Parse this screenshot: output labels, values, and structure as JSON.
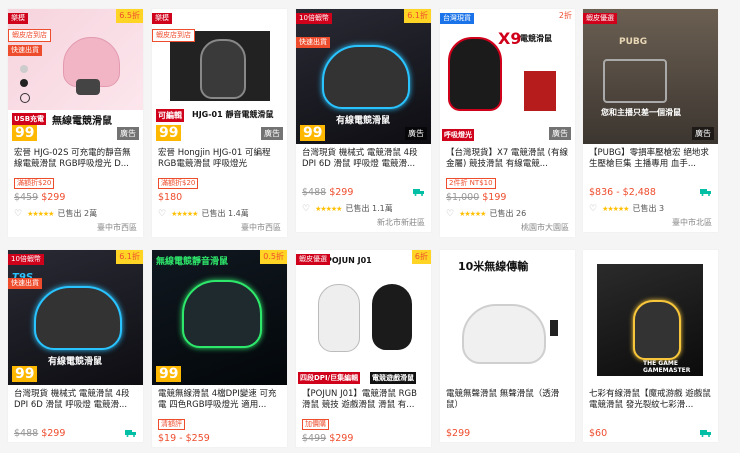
{
  "colors": {
    "brand": "#ee4d2d",
    "mall": "#d0011b",
    "taiwan": "#1a73e8",
    "rating": "#ffc107"
  },
  "products": [
    {
      "tag": "樂模",
      "tag2": "蝦皮店到店",
      "tag3": "快速出貨",
      "discount": "6.5折",
      "art": [
        "USB充電",
        "無線電競滑鼠",
        "99"
      ],
      "ad": "廣告",
      "title": "宏晉 HJG-02S 可充電的靜音無線電競滑鼠 RGB呼吸燈光 D...",
      "badge": "滿額折$20",
      "old_price": "$459",
      "price": "$299",
      "sold": "已售出 2萬",
      "location": "臺中市西區"
    },
    {
      "tag": "樂模",
      "tag2": "蝦皮店到店",
      "tag3": "",
      "discount": "",
      "art": [
        "可編輯",
        "HJG-01 靜音電競滑鼠",
        "99"
      ],
      "ad": "廣告",
      "title": "宏晉 Hongjin HJG-01 可編程 RGB電競滑鼠 呼吸燈光",
      "badge": "滿額折$20",
      "old_price": "",
      "price": "$180",
      "sold": "已售出 1.4萬",
      "location": "臺中市西區"
    },
    {
      "tag": "10倍蝦幣",
      "tag2": "快速出貨",
      "tag3": "",
      "discount": "6.1折",
      "art": [
        "T9S",
        "有線電競滑鼠",
        "99"
      ],
      "ad": "廣告",
      "title": "台灣現貨 機械式 電競滑鼠 4段 DPI 6D 滑鼠 呼吸燈 電競滑...",
      "badge": "",
      "old_price": "$488",
      "price": "$299",
      "sold": "已售出 1.1萬",
      "location": "新北市新莊區"
    },
    {
      "tag": "台灣現貨",
      "tag2": "",
      "tag3": "",
      "discount": "2折",
      "art": [
        "X9",
        "電競滑鼠",
        "呼吸燈光"
      ],
      "ad": "廣告",
      "title": "【台灣現貨】X7 電競滑鼠 (有線金屬) 競技滑鼠 有線電競...",
      "badge": "2件折 NT$10",
      "old_price": "$1,000",
      "price": "$199",
      "sold": "已售出 26",
      "location": "桃園市大園區"
    },
    {
      "tag": "蝦皮優選",
      "tag2": "",
      "tag3": "",
      "discount": "",
      "art": [
        "PUBG",
        "您和主播只差一個滑鼠"
      ],
      "ad": "廣告",
      "title": "【PUBG】零損率壓槍宏 絕地求生壓槍巨集 主播專用 血手...",
      "badge": "",
      "old_price": "",
      "price": "$836 - $2,488",
      "sold": "已售出 3",
      "location": "臺中市北區"
    },
    {
      "tag": "10倍蝦幣",
      "tag2": "快速出貨",
      "tag3": "",
      "discount": "6.1折",
      "art": [
        "T9S",
        "有線電競滑鼠",
        "99"
      ],
      "ad": "",
      "title": "台灣現貨 機械式 電競滑鼠 4段 DPI 6D 滑鼠 呼吸燈 電競滑...",
      "badge": "",
      "old_price": "$488",
      "price": "$299",
      "sold": "",
      "location": ""
    },
    {
      "tag": "",
      "tag2": "",
      "tag3": "",
      "discount": "0.5折",
      "art": [
        "無線電競靜音滑鼠",
        "99"
      ],
      "ad": "",
      "title": "電競無線滑鼠 4檔DPI變速 可充電 四色RGB呼吸燈光 適用...",
      "badge": "清額評",
      "old_price": "",
      "price": "$19 - $259",
      "sold": "",
      "location": ""
    },
    {
      "tag": "蝦皮優選",
      "tag2": "",
      "tag3": "",
      "discount": "6折",
      "art": [
        "POJUN J01",
        "四段DPI/巨集編輯",
        "電競遊戲滑鼠"
      ],
      "ad": "",
      "title": "【POJUN J01】電競滑鼠 RGB滑鼠 競技 遊戲滑鼠 滑鼠 有...",
      "badge": "加價購",
      "old_price": "$499",
      "price": "$299",
      "sold": "",
      "location": ""
    },
    {
      "tag": "",
      "tag2": "",
      "tag3": "",
      "discount": "",
      "art": [
        "10米無線傳輸"
      ],
      "ad": "",
      "title": "電競無聲滑鼠 無聲滑鼠（透滑鼠）",
      "badge": "",
      "old_price": "",
      "price": "$299",
      "sold": "",
      "location": ""
    },
    {
      "tag": "",
      "tag2": "",
      "tag3": "",
      "discount": "",
      "art": [
        "THE GAME GAMEMASTER"
      ],
      "ad": "",
      "title": "七彩有線滑鼠【魔戒游戲 遊戲鼠 電競滑鼠 發光裂紋七彩滑...",
      "badge": "",
      "old_price": "",
      "price": "$60",
      "sold": "",
      "location": ""
    }
  ]
}
